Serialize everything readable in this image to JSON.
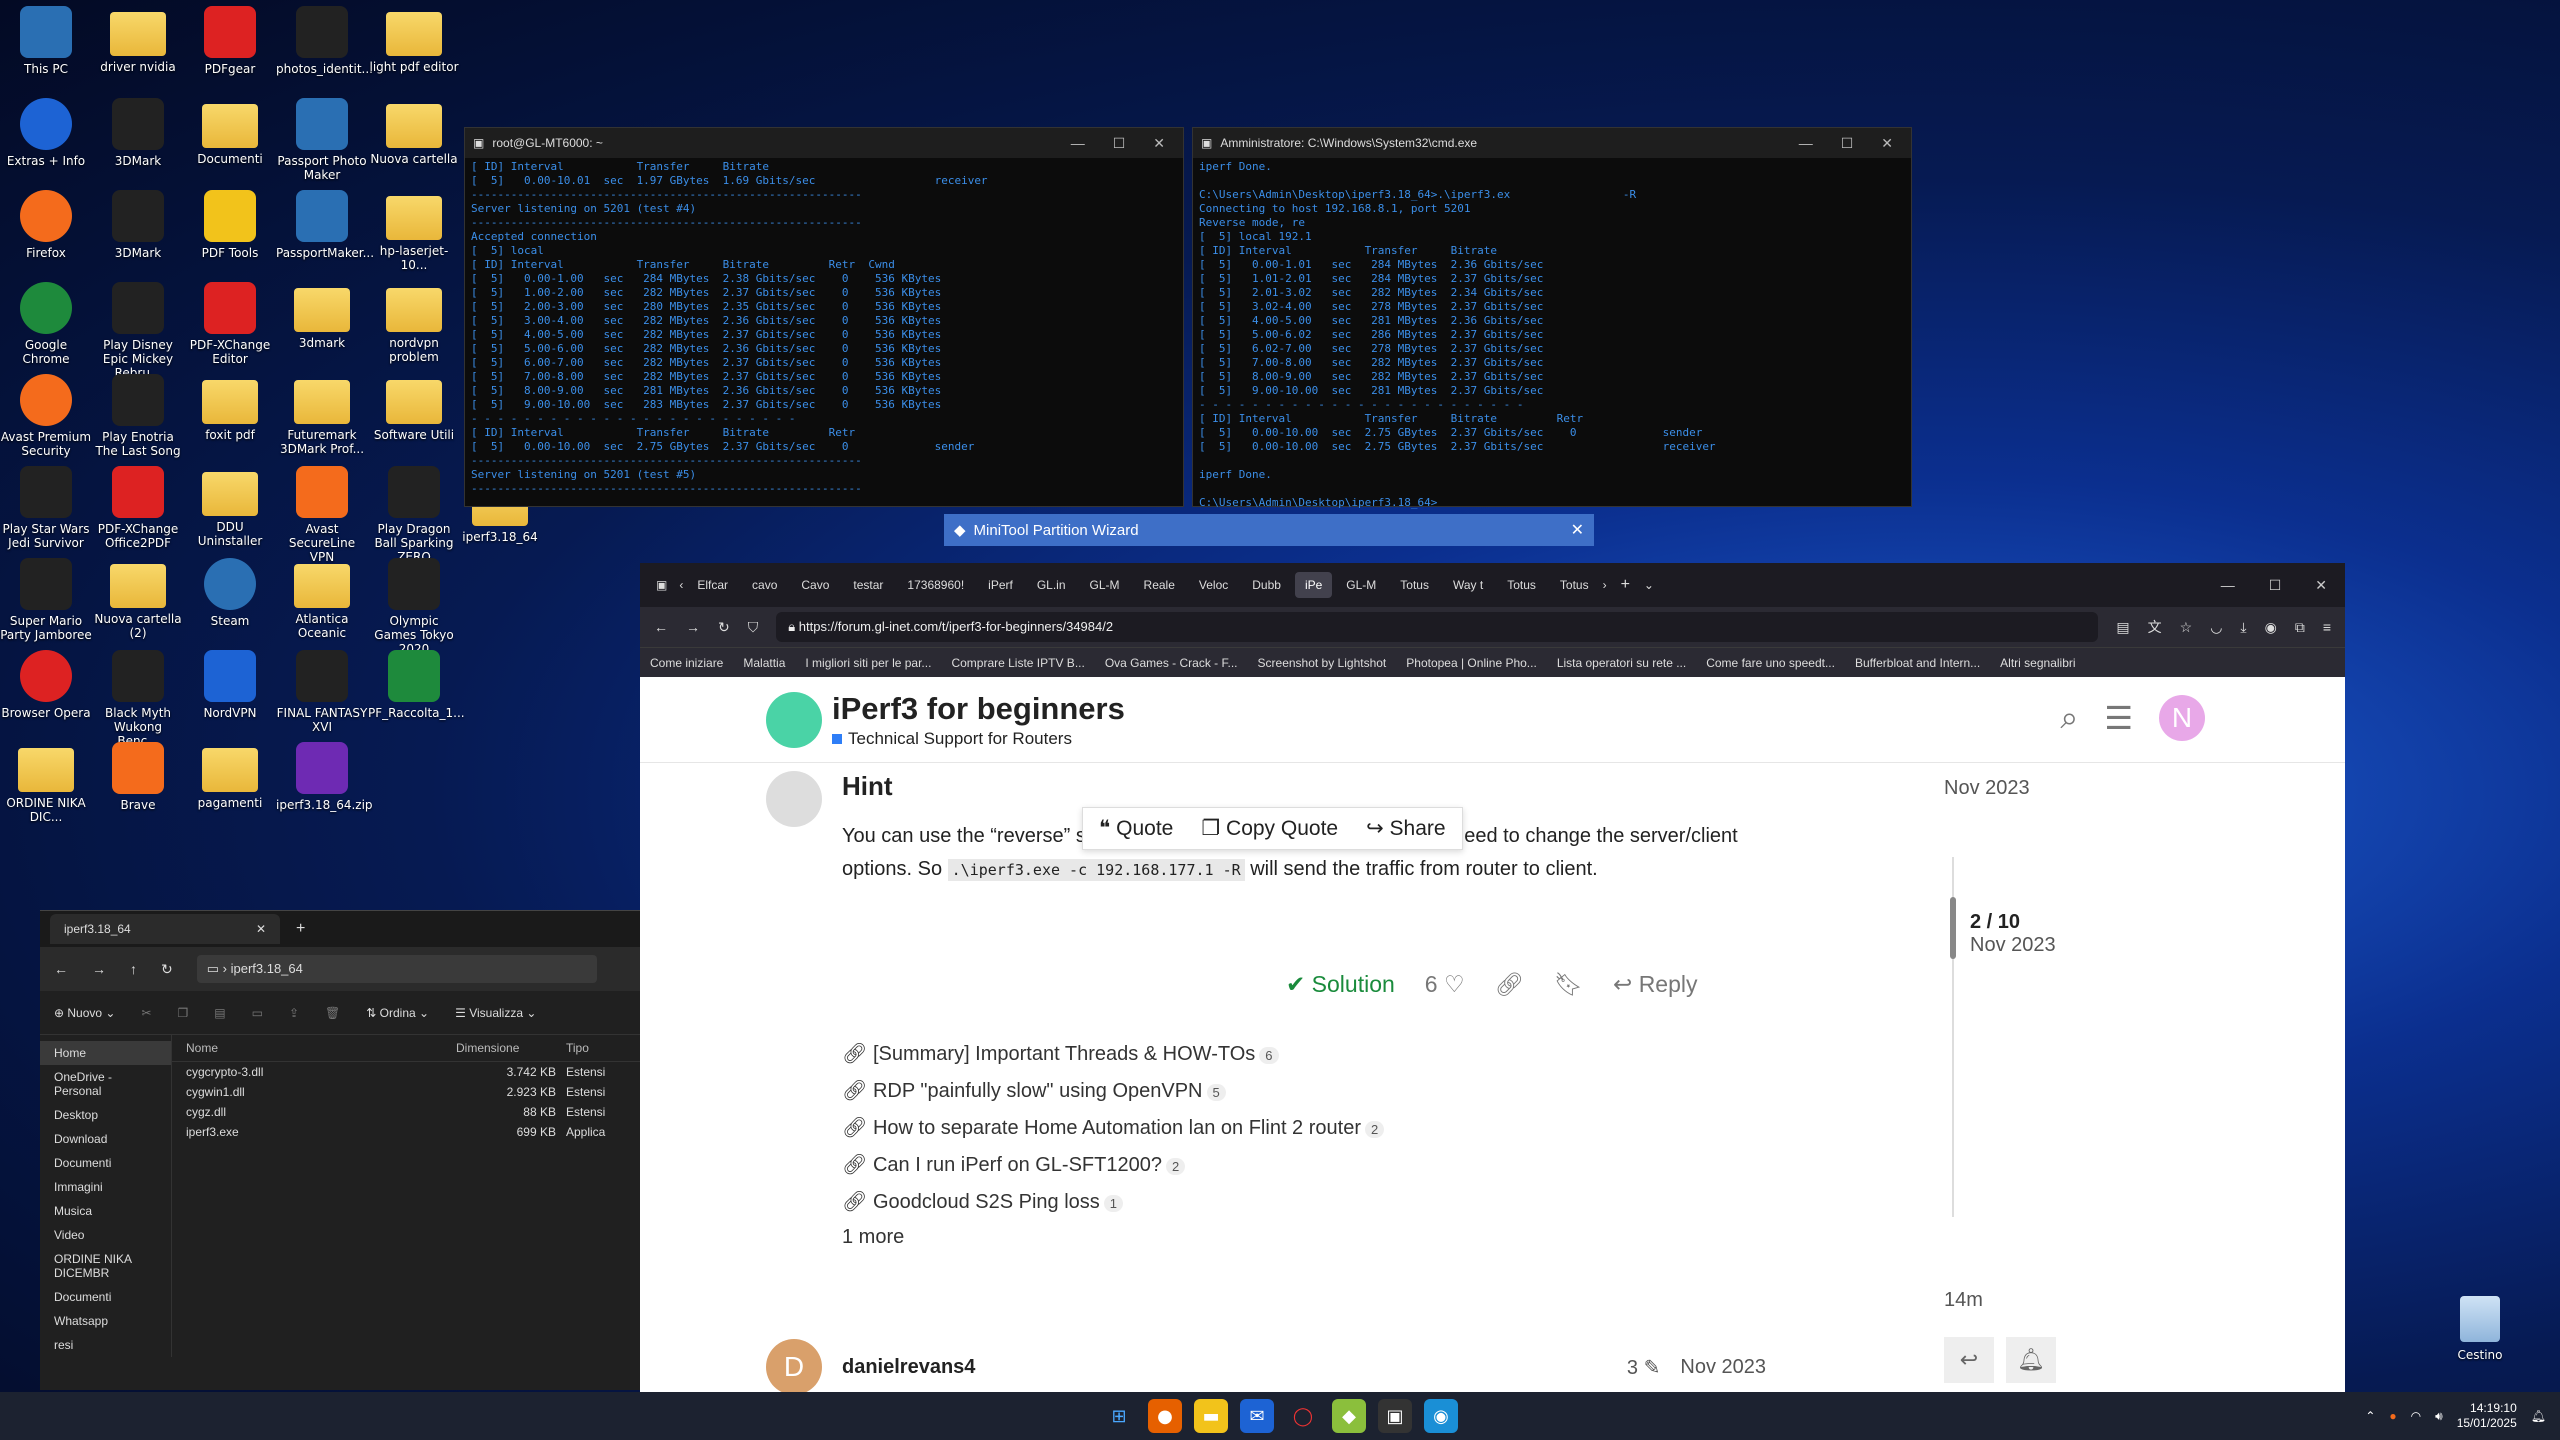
{
  "desktop_icons": [
    {
      "label": "This PC",
      "icon": "monitor-icon"
    },
    {
      "label": "driver nvidia",
      "icon": "folder-icon"
    },
    {
      "label": "PDFgear",
      "icon": "pdf-icon"
    },
    {
      "label": "photos_identit...",
      "icon": "photo-icon"
    },
    {
      "label": "light pdf editor",
      "icon": "folder-icon"
    },
    {
      "label": "Extras + Info",
      "icon": "globe-icon"
    },
    {
      "label": "3DMark",
      "icon": "3dmark-icon"
    },
    {
      "label": "Documenti",
      "icon": "folder-icon"
    },
    {
      "label": "Passport Photo Maker",
      "icon": "passport-icon"
    },
    {
      "label": "Nuova cartella",
      "icon": "folder-icon"
    },
    {
      "label": "Firefox",
      "icon": "firefox-icon"
    },
    {
      "label": "3DMark",
      "icon": "3dmark-icon"
    },
    {
      "label": "PDF Tools",
      "icon": "pdf-tools-icon"
    },
    {
      "label": "PassportMaker...",
      "icon": "passport-icon"
    },
    {
      "label": "hp-laserjet-10...",
      "icon": "folder-icon"
    },
    {
      "label": "Google Chrome",
      "icon": "chrome-icon"
    },
    {
      "label": "Play Disney Epic Mickey Rebru...",
      "icon": "game-icon"
    },
    {
      "label": "PDF-XChange Editor",
      "icon": "pdf-icon"
    },
    {
      "label": "3dmark",
      "icon": "folder-icon"
    },
    {
      "label": "nordvpn problem",
      "icon": "folder-icon"
    },
    {
      "label": "Avast Premium Security",
      "icon": "avast-icon"
    },
    {
      "label": "Play Enotria The Last Song",
      "icon": "game-icon"
    },
    {
      "label": "foxit pdf",
      "icon": "folder-icon"
    },
    {
      "label": "Futuremark 3DMark Prof...",
      "icon": "folder-icon"
    },
    {
      "label": "Software Utili",
      "icon": "folder-icon"
    },
    {
      "label": "Play Star Wars Jedi Survivor",
      "icon": "game-icon"
    },
    {
      "label": "PDF-XChange Office2PDF",
      "icon": "pdf-icon"
    },
    {
      "label": "DDU Uninstaller",
      "icon": "folder-icon"
    },
    {
      "label": "Avast SecureLine VPN",
      "icon": "vpn-icon"
    },
    {
      "label": "Play Dragon Ball Sparking ZERO",
      "icon": "game-icon"
    },
    {
      "label": "Super Mario Party Jamboree",
      "icon": "game-icon"
    },
    {
      "label": "Nuova cartella (2)",
      "icon": "folder-icon"
    },
    {
      "label": "Steam",
      "icon": "steam-icon"
    },
    {
      "label": "Atlantica Oceanic",
      "icon": "folder-icon"
    },
    {
      "label": "Olympic Games Tokyo 2020",
      "icon": "game-icon"
    },
    {
      "label": "Browser Opera",
      "icon": "opera-icon"
    },
    {
      "label": "Black Myth Wukong Benc...",
      "icon": "game-icon"
    },
    {
      "label": "NordVPN",
      "icon": "nordvpn-icon"
    },
    {
      "label": "FINAL FANTASY XVI",
      "icon": "game-icon"
    },
    {
      "label": "PF_Raccolta_1...",
      "icon": "excel-icon"
    },
    {
      "label": "ORDINE NIKA DIC...",
      "icon": "folder-icon"
    },
    {
      "label": "Brave",
      "icon": "brave-icon"
    },
    {
      "label": "pagamenti",
      "icon": "folder-icon"
    },
    {
      "label": "iperf3.18_64.zip",
      "icon": "winrar-icon"
    }
  ],
  "iperf_folder_label": "iperf3.18_64",
  "term1": {
    "title": "root@GL-MT6000: ~",
    "lines": [
      "[ ID] Interval           Transfer     Bitrate",
      "[  5]   0.00-10.01  sec  1.97 GBytes  1.69 Gbits/sec                  receiver",
      "-----------------------------------------------------------",
      "Server listening on 5201 (test #4)",
      "-----------------------------------------------------------",
      "Accepted connection",
      "[  5] local",
      "[ ID] Interval           Transfer     Bitrate         Retr  Cwnd",
      "[  5]   0.00-1.00   sec   284 MBytes  2.38 Gbits/sec    0    536 KBytes",
      "[  5]   1.00-2.00   sec   282 MBytes  2.37 Gbits/sec    0    536 KBytes",
      "[  5]   2.00-3.00   sec   280 MBytes  2.35 Gbits/sec    0    536 KBytes",
      "[  5]   3.00-4.00   sec   282 MBytes  2.36 Gbits/sec    0    536 KBytes",
      "[  5]   4.00-5.00   sec   282 MBytes  2.37 Gbits/sec    0    536 KBytes",
      "[  5]   5.00-6.00   sec   282 MBytes  2.36 Gbits/sec    0    536 KBytes",
      "[  5]   6.00-7.00   sec   282 MBytes  2.37 Gbits/sec    0    536 KBytes",
      "[  5]   7.00-8.00   sec   282 MBytes  2.37 Gbits/sec    0    536 KBytes",
      "[  5]   8.00-9.00   sec   281 MBytes  2.36 Gbits/sec    0    536 KBytes",
      "[  5]   9.00-10.00  sec   283 MBytes  2.37 Gbits/sec    0    536 KBytes",
      "- - - - - - - - - - - - - - - - - - - - - - - - -",
      "[ ID] Interval           Transfer     Bitrate         Retr",
      "[  5]   0.00-10.00  sec  2.75 GBytes  2.37 Gbits/sec    0             sender",
      "-----------------------------------------------------------",
      "Server listening on 5201 (test #5)",
      "-----------------------------------------------------------"
    ]
  },
  "term2": {
    "title": "Amministratore: C:\\Windows\\System32\\cmd.exe",
    "lines": [
      "iperf Done.",
      "",
      "C:\\Users\\Admin\\Desktop\\iperf3.18_64>.\\iperf3.ex                 -R",
      "Connecting to host 192.168.8.1, port 5201",
      "Reverse mode, re",
      "[  5] local 192.1",
      "[ ID] Interval           Transfer     Bitrate",
      "[  5]   0.00-1.01   sec   284 MBytes  2.36 Gbits/sec",
      "[  5]   1.01-2.01   sec   284 MBytes  2.37 Gbits/sec",
      "[  5]   2.01-3.02   sec   282 MBytes  2.34 Gbits/sec",
      "[  5]   3.02-4.00   sec   278 MBytes  2.37 Gbits/sec",
      "[  5]   4.00-5.00   sec   281 MBytes  2.36 Gbits/sec",
      "[  5]   5.00-6.02   sec   286 MBytes  2.37 Gbits/sec",
      "[  5]   6.02-7.00   sec   278 MBytes  2.37 Gbits/sec",
      "[  5]   7.00-8.00   sec   282 MBytes  2.37 Gbits/sec",
      "[  5]   8.00-9.00   sec   282 MBytes  2.37 Gbits/sec",
      "[  5]   9.00-10.00  sec   281 MBytes  2.37 Gbits/sec",
      "- - - - - - - - - - - - - - - - - - - - - - - - -",
      "[ ID] Interval           Transfer     Bitrate         Retr",
      "[  5]   0.00-10.00  sec  2.75 GBytes  2.37 Gbits/sec    0             sender",
      "[  5]   0.00-10.00  sec  2.75 GBytes  2.37 Gbits/sec                  receiver",
      "",
      "iperf Done.",
      "",
      "C:\\Users\\Admin\\Desktop\\iperf3.18_64>"
    ]
  },
  "minitool": {
    "title": "MiniTool Partition Wizard"
  },
  "explorer": {
    "tab_title": "iperf3.18_64",
    "path": "iperf3.18_64",
    "toolbar": {
      "new": "Nuovo",
      "sort": "Ordina",
      "view": "Visualizza"
    },
    "sidebar": [
      "Home",
      "OneDrive - Personal",
      "Desktop",
      "Download",
      "Documenti",
      "Immagini",
      "Musica",
      "Video",
      "ORDINE NIKA DICEMBR",
      "Documenti",
      "Whatsapp",
      "resi"
    ],
    "columns": [
      "Nome",
      "Dimensione",
      "Tipo"
    ],
    "files": [
      {
        "name": "cygcrypto-3.dll",
        "size": "3.742 KB",
        "type": "Estensi"
      },
      {
        "name": "cygwin1.dll",
        "size": "2.923 KB",
        "type": "Estensi"
      },
      {
        "name": "cygz.dll",
        "size": "88 KB",
        "type": "Estensi"
      },
      {
        "name": "iperf3.exe",
        "size": "699 KB",
        "type": "Applica"
      }
    ]
  },
  "browser": {
    "tabs": [
      "Elfcar",
      "cavo",
      "Cavo",
      "testar",
      "17368960!",
      "iPerf",
      "GL.in",
      "GL-M",
      "Reale",
      "Veloc",
      "Dubb",
      "iPe",
      "GL-M",
      "Totus",
      "Way t",
      "Totus",
      "Totus"
    ],
    "active_tab_index": 11,
    "url": "https://forum.gl-inet.com/t/iperf3-for-beginners/34984/2",
    "bookmarks": [
      "Come iniziare",
      "Malattia",
      "I migliori siti per le par...",
      "Comprare Liste IPTV B...",
      "Ova Games - Crack - F...",
      "Screenshot by Lightshot",
      "Photopea | Online Pho...",
      "Lista operatori su rete ...",
      "Come fare uno speedt...",
      "Bufferbloat and Intern...",
      "Altri segnalibri"
    ],
    "topic_title": "iPerf3 for beginners",
    "category": "Technical Support for Routers",
    "avatar_letter": "N",
    "post": {
      "author": "Hint",
      "text_before": "You can use the “reverse” switch",
      "code1": "-R",
      "text_mid": "hout need to change the server/client options. So",
      "code2": ".\\iperf3.exe -c 192.168.177.1 -R",
      "text_after": "will send the traffic from router to client.",
      "quote_label": "Quote",
      "copy_quote_label": "Copy Quote",
      "share_label": "Share",
      "solution_label": "Solution",
      "likes": "6",
      "reply_label": "Reply"
    },
    "links": [
      {
        "text": "[Summary] Important Threads & HOW-TOs",
        "count": "6"
      },
      {
        "text": "RDP \"painfully slow\" using OpenVPN",
        "count": "5"
      },
      {
        "text": "How to separate Home Automation lan on Flint 2 router",
        "count": "2"
      },
      {
        "text": "Can I run iPerf on GL-SFT1200?",
        "count": "2"
      },
      {
        "text": "Goodcloud S2S Ping loss",
        "count": "1"
      }
    ],
    "more_label": "1 more",
    "timeline": {
      "top_date": "Nov 2023",
      "position": "2 / 10",
      "position_date": "Nov 2023",
      "bottom": "14m"
    },
    "next_post": {
      "author": "danielrevans4",
      "avatar_letter": "D",
      "edits": "3",
      "date": "Nov 2023"
    }
  },
  "recycle_bin": "Cestino",
  "clock": {
    "time": "14:19:10",
    "date": "15/01/2025"
  }
}
